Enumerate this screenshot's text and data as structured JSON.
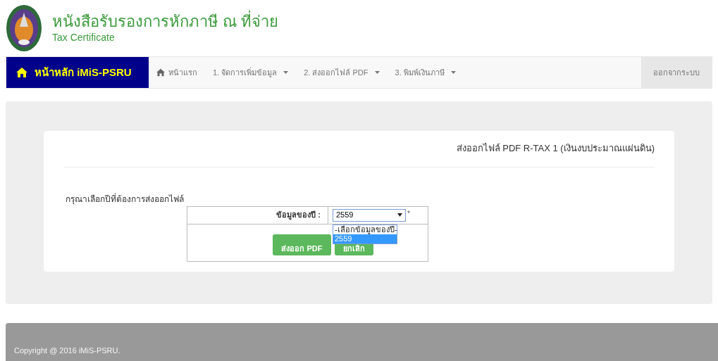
{
  "header": {
    "title": "หนังสือรับรองการหักภาษี ณ ที่จ่าย",
    "subtitle": "Tax Certificate"
  },
  "navbar": {
    "brand": "หน้าหลัก iMiS-PSRU",
    "items": [
      {
        "label": "หน้าแรก",
        "kind": "home"
      },
      {
        "label": "1. จัดการเพิ่มข้อมูล",
        "kind": "dropdown"
      },
      {
        "label": "2. ส่งออกไฟล์ PDF",
        "kind": "dropdown"
      },
      {
        "label": "3. พิมพ์เงินภาษี",
        "kind": "dropdown"
      }
    ],
    "logout": "ออกจากระบบ"
  },
  "card": {
    "heading": "ส่งออกไฟล์ PDF R-TAX 1 (เงินงบประมาณแผ่นดิน)",
    "prompt": "กรุณาเลือกปีที่ต้องการส่งออกไฟล์",
    "field_label": "ข้อมูลของปี :",
    "select": {
      "value": "2559",
      "required_mark": "*",
      "expanded": true,
      "options": [
        {
          "label": "-เลือกข้อมูลของปี-",
          "selected": false
        },
        {
          "label": "2559",
          "selected": true
        }
      ]
    },
    "buttons": [
      "ส่งออก PDF",
      "ยกเลิก"
    ]
  },
  "footer": "Copyright @ 2016 iMiS-PSRU."
}
